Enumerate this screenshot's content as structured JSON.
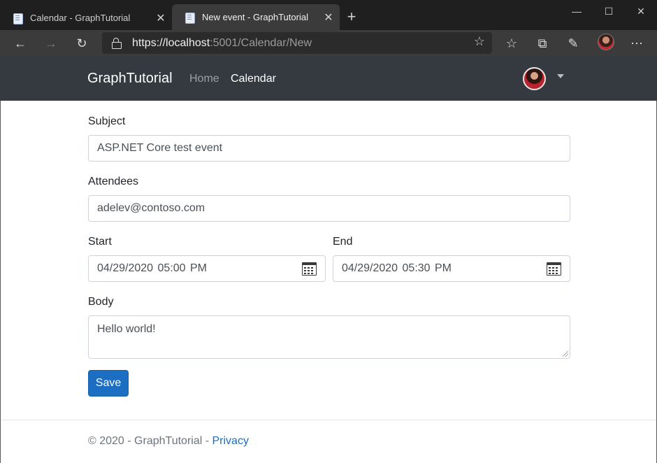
{
  "browser": {
    "tabs": [
      {
        "title": "Calendar - GraphTutorial",
        "active": false
      },
      {
        "title": "New event - GraphTutorial",
        "active": true
      }
    ],
    "url": {
      "scheme": "https://",
      "host": "localhost",
      "rest": ":5001/Calendar/New"
    }
  },
  "navbar": {
    "brand": "GraphTutorial",
    "links": [
      "Home",
      "Calendar"
    ],
    "active_link": "Calendar"
  },
  "form": {
    "subject": {
      "label": "Subject",
      "value": "ASP.NET Core test event"
    },
    "attendees": {
      "label": "Attendees",
      "value": "adelev@contoso.com"
    },
    "start": {
      "label": "Start",
      "value": "04/29/2020 05:00 PM"
    },
    "end": {
      "label": "End",
      "value": "04/29/2020 05:30 PM"
    },
    "body": {
      "label": "Body",
      "value": "Hello world!"
    },
    "save_label": "Save"
  },
  "footer": {
    "text": "© 2020 - GraphTutorial - ",
    "privacy_link": "Privacy"
  },
  "colors": {
    "navbar_bg": "#343a40",
    "primary": "#1b6ec2",
    "browser_dark": "#1f1f1f"
  }
}
